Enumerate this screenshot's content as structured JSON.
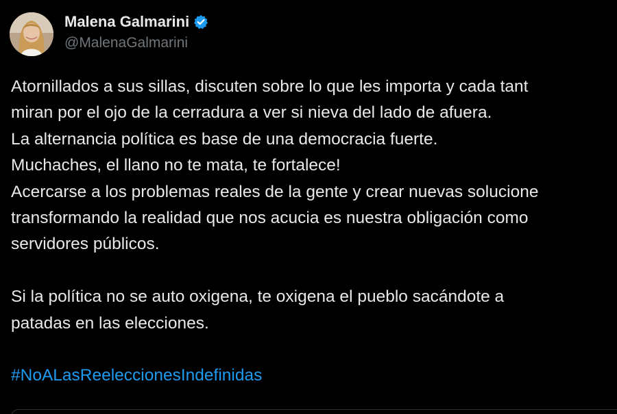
{
  "author": {
    "display_name": "Malena Galmarini",
    "handle": "@MalenaGalmarini",
    "verified": true,
    "avatar_icon": "profile-photo-avatar",
    "verified_icon": "verified-badge-icon"
  },
  "tweet": {
    "lines": [
      "Atornillados a sus sillas, discuten sobre lo que les importa y cada tant",
      "miran por el ojo de la cerradura a ver si nieva del lado de afuera.",
      "La alternancia política es base de una democracia fuerte.",
      "Muchaches, el llano no te mata, te fortalece!",
      "Acercarse a los problemas reales de la gente y crear nuevas solucione",
      "transformando la realidad que nos acucia es nuestra obligación como",
      "servidores públicos."
    ],
    "lines2": [
      "Si la política no se auto oxigena, te oxigena el pueblo sacándote a",
      "patadas en las elecciones."
    ],
    "hashtag": "#NoALasReeleccionesIndefinidas"
  },
  "colors": {
    "background": "#000000",
    "text": "#e7e9ea",
    "secondary_text": "#71767b",
    "link": "#1d9bf0",
    "verified_badge": "#1d9bf0"
  }
}
